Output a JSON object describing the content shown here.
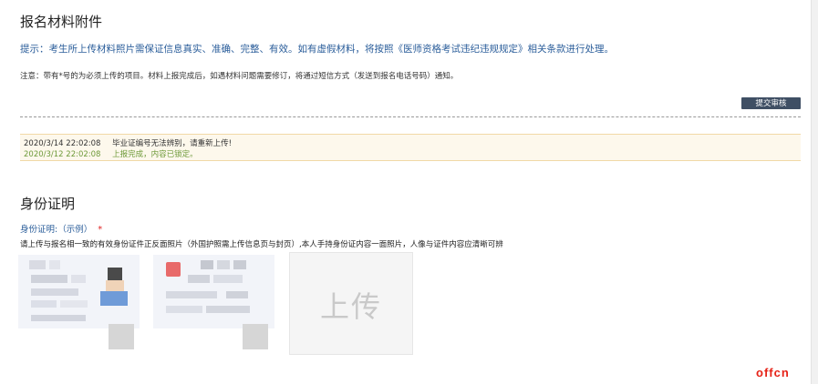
{
  "materials": {
    "title": "报名材料附件",
    "hint": "提示：考生所上传材料照片需保证信息真实、准确、完整、有效。如有虚假材料，将按照《医师资格考试违纪违规规定》相关条款进行处理。",
    "note": "注意：带有*号的为必须上传的项目。材料上报完成后，如遇材料问题需要修订，将通过短信方式（发送到报名电话号码）通知。",
    "submit_label": "提交审核"
  },
  "log": [
    {
      "time": "2020/3/14 22:02:08",
      "message": "毕业证编号无法辨别，请重新上传!"
    },
    {
      "time": "2020/3/12 22:02:08",
      "message": "上报完成，内容已锁定。"
    }
  ],
  "id_section": {
    "title": "身份证明",
    "field_label": "身份证明:（示例）",
    "required_mark": "*",
    "description": "请上传与报名相一致的有效身份证件正反面照片（外国护照需上传信息页与封页）,本人手持身份证内容一面照片，人像与证件内容应清晰可辨",
    "upload_label": "上传"
  },
  "watermark": "offcn"
}
